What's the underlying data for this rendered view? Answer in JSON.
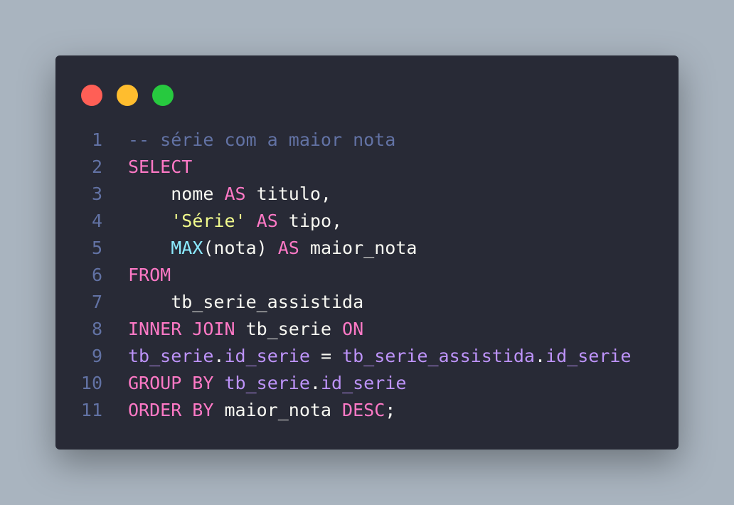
{
  "colors": {
    "background": "#a9b4bf",
    "window": "#282a36",
    "dot_red": "#ff5f56",
    "dot_yellow": "#ffbd2e",
    "dot_green": "#27c93f",
    "comment": "#6272a4",
    "keyword": "#ff79c6",
    "string": "#f1fa8c",
    "function": "#8be9fd",
    "identifier": "#bd93f9",
    "text": "#f8f8f2"
  },
  "window_controls": [
    "close-dot",
    "minimize-dot",
    "maximize-dot"
  ],
  "code": {
    "lines": [
      {
        "num": "1",
        "tokens": [
          {
            "t": "-- série com a maior nota",
            "c": "comment"
          }
        ]
      },
      {
        "num": "2",
        "tokens": [
          {
            "t": "SELECT",
            "c": "kw"
          }
        ]
      },
      {
        "num": "3",
        "tokens": [
          {
            "t": "    nome ",
            "c": "plain"
          },
          {
            "t": "AS",
            "c": "kw"
          },
          {
            "t": " titulo,",
            "c": "plain"
          }
        ]
      },
      {
        "num": "4",
        "tokens": [
          {
            "t": "    ",
            "c": "plain"
          },
          {
            "t": "'Série'",
            "c": "str"
          },
          {
            "t": " ",
            "c": "plain"
          },
          {
            "t": "AS",
            "c": "kw"
          },
          {
            "t": " tipo,",
            "c": "plain"
          }
        ]
      },
      {
        "num": "5",
        "tokens": [
          {
            "t": "    ",
            "c": "plain"
          },
          {
            "t": "MAX",
            "c": "fn"
          },
          {
            "t": "(nota) ",
            "c": "plain"
          },
          {
            "t": "AS",
            "c": "kw"
          },
          {
            "t": " maior_nota",
            "c": "plain"
          }
        ]
      },
      {
        "num": "6",
        "tokens": [
          {
            "t": "FROM",
            "c": "kw"
          }
        ]
      },
      {
        "num": "7",
        "tokens": [
          {
            "t": "    tb_serie_assistida",
            "c": "plain"
          }
        ]
      },
      {
        "num": "8",
        "tokens": [
          {
            "t": "INNER JOIN",
            "c": "kw"
          },
          {
            "t": " tb_serie ",
            "c": "plain"
          },
          {
            "t": "ON",
            "c": "kw"
          }
        ]
      },
      {
        "num": "9",
        "tokens": [
          {
            "t": "tb_serie",
            "c": "id"
          },
          {
            "t": ".",
            "c": "plain"
          },
          {
            "t": "id_serie",
            "c": "id"
          },
          {
            "t": " = ",
            "c": "plain"
          },
          {
            "t": "tb_serie_assistida",
            "c": "id"
          },
          {
            "t": ".",
            "c": "plain"
          },
          {
            "t": "id_serie",
            "c": "id"
          }
        ]
      },
      {
        "num": "10",
        "tokens": [
          {
            "t": "GROUP BY",
            "c": "kw"
          },
          {
            "t": " ",
            "c": "plain"
          },
          {
            "t": "tb_serie",
            "c": "id"
          },
          {
            "t": ".",
            "c": "plain"
          },
          {
            "t": "id_serie",
            "c": "id"
          }
        ]
      },
      {
        "num": "11",
        "tokens": [
          {
            "t": "ORDER BY",
            "c": "kw"
          },
          {
            "t": " maior_nota ",
            "c": "plain"
          },
          {
            "t": "DESC",
            "c": "kw"
          },
          {
            "t": ";",
            "c": "plain"
          }
        ]
      }
    ]
  }
}
